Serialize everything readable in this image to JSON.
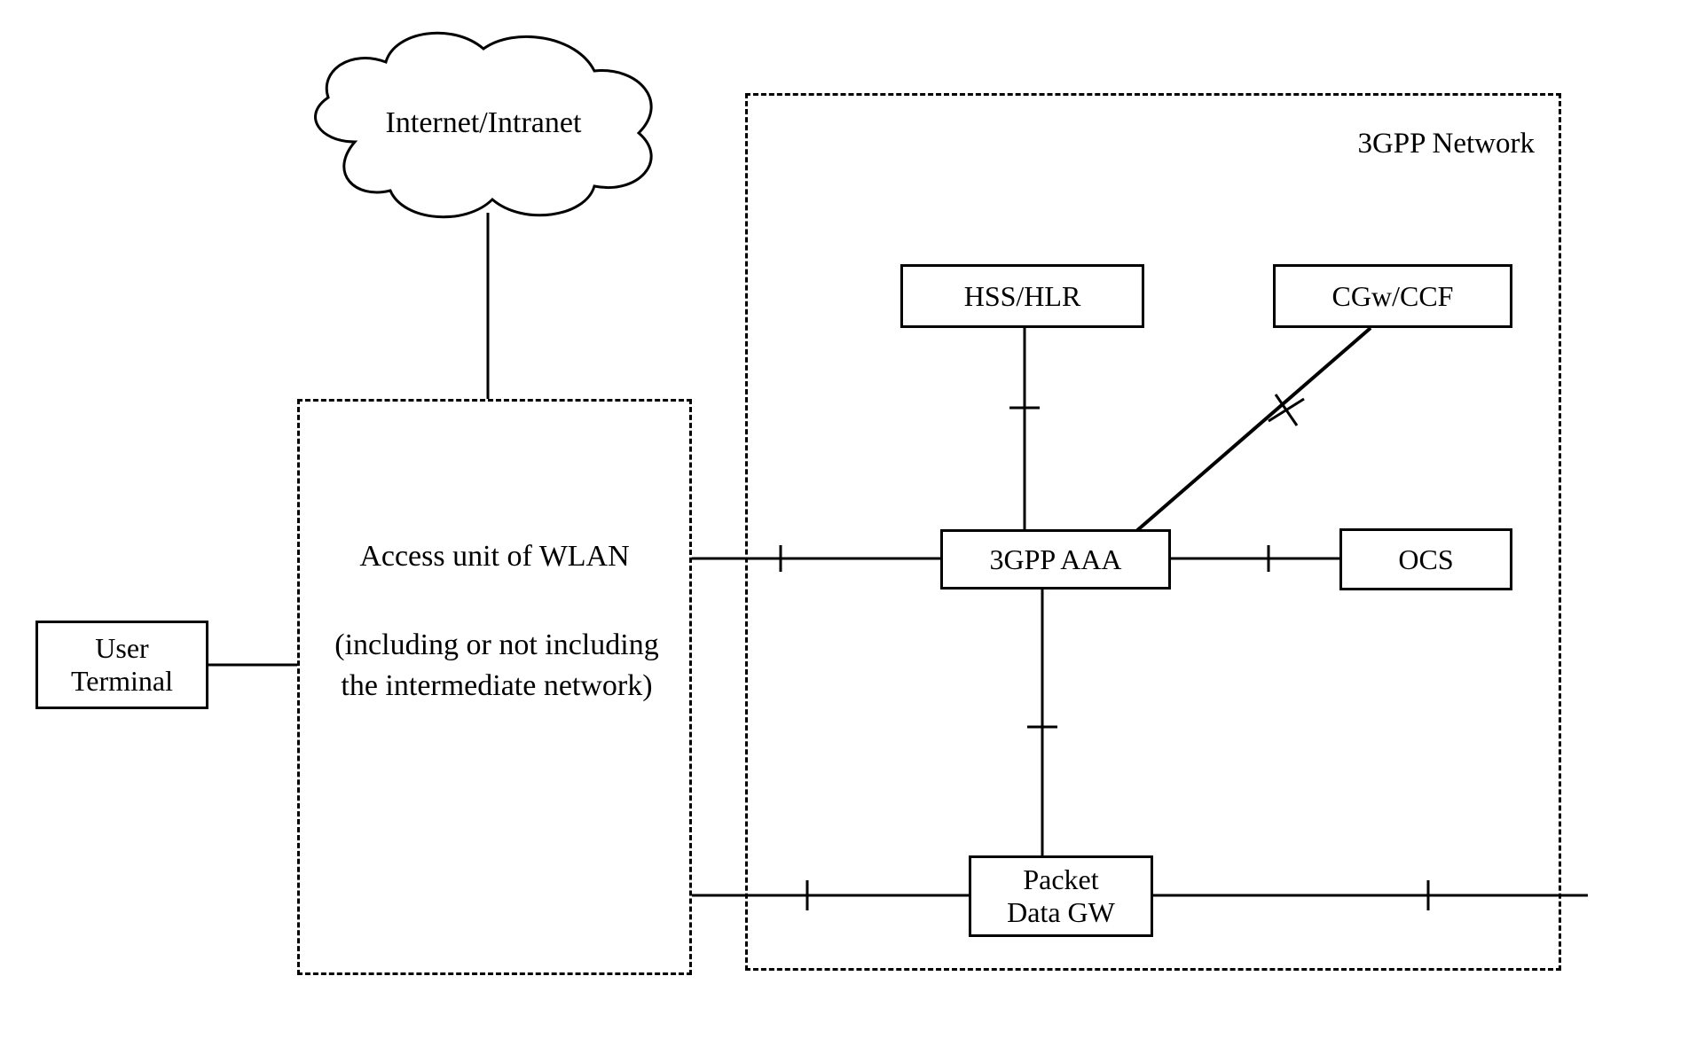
{
  "nodes": {
    "internet": "Internet/Intranet",
    "user_terminal": "User\nTerminal",
    "wlan_title": "Access unit of WLAN",
    "wlan_sub": "(including or not including\nthe intermediate network)",
    "gpp_network": "3GPP Network",
    "hss_hlr": "HSS/HLR",
    "cgw_ccf": "CGw/CCF",
    "gpp_aaa": "3GPP AAA",
    "ocs": "OCS",
    "packet_gw": "Packet\nData GW"
  }
}
